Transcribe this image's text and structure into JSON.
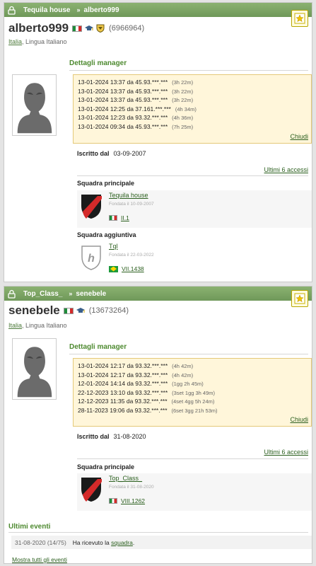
{
  "profiles": [
    {
      "breadcrumb_team": "Tequila house",
      "breadcrumb_sep": "»",
      "breadcrumb_user": "alberto999",
      "username": "alberto999",
      "user_id": "(6966964)",
      "location_country": "Italia",
      "location_lang": ", Lingua Italiano",
      "manager_details_title": "Dettagli manager",
      "log": [
        {
          "text": "13-01-2024 13:37 da 45.93.***.***",
          "dur": "(3h 22m)"
        },
        {
          "text": "13-01-2024 13:37 da 45.93.***.***",
          "dur": "(3h 22m)"
        },
        {
          "text": "13-01-2024 13:37 da 45.93.***.***",
          "dur": "(3h 22m)"
        },
        {
          "text": "13-01-2024 12:25 da 37.161.***.***",
          "dur": "(4h 34m)"
        },
        {
          "text": "13-01-2024 12:23 da 93.32.***.***",
          "dur": "(4h 36m)"
        },
        {
          "text": "13-01-2024 09:34 da 45.93.***.***",
          "dur": "(7h 25m)"
        }
      ],
      "close_label": "Chiudi",
      "registered_label": "Iscritto dal",
      "registered_date": "03-09-2007",
      "last_access_label": "Ultimi 6 accessi",
      "main_team_title": "Squadra principale",
      "main_team": {
        "name": "Tequila house",
        "founded": "Fondata il 10-09-2007",
        "division": "II.1"
      },
      "extra_team_title": "Squadra aggiuntiva",
      "extra_team": {
        "name": "Tql",
        "founded": "Fondata il 22-03-2022",
        "division": "VII.1438"
      }
    },
    {
      "breadcrumb_team": "Top_Class_",
      "breadcrumb_sep": "»",
      "breadcrumb_user": "senebele",
      "username": "senebele",
      "user_id": "(13673264)",
      "location_country": "Italia",
      "location_lang": ", Lingua Italiano",
      "manager_details_title": "Dettagli manager",
      "log": [
        {
          "text": "13-01-2024 12:17 da 93.32.***.***",
          "dur": "(4h 42m)"
        },
        {
          "text": "13-01-2024 12:17 da 93.32.***.***",
          "dur": "(4h 42m)"
        },
        {
          "text": "12-01-2024 14:14 da 93.32.***.***",
          "dur": "(1gg 2h 45m)"
        },
        {
          "text": "22-12-2023 13:10 da 93.32.***.***",
          "dur": "(3set 1gg 3h 49m)"
        },
        {
          "text": "12-12-2023 11:35 da 93.32.***.***",
          "dur": "(4set 4gg 5h 24m)"
        },
        {
          "text": "28-11-2023 19:06 da 93.32.***.***",
          "dur": "(6set 3gg 21h 53m)"
        }
      ],
      "close_label": "Chiudi",
      "registered_label": "Iscritto dal",
      "registered_date": "31-08-2020",
      "last_access_label": "Ultimi 6 accessi",
      "main_team_title": "Squadra principale",
      "main_team": {
        "name": "Top_Class_",
        "founded": "Fondata il 31-08-2020",
        "division": "VIII.1262"
      },
      "events_title": "Ultimi eventi",
      "event": {
        "date": "31-08-2020 (14/75)",
        "text_before": "Ha ricevuto la ",
        "link": "squadra",
        "text_after": "."
      },
      "all_events_label": "Mostra tutti gli eventi"
    }
  ],
  "colors": {
    "header_green": "#7aa463",
    "accent_green": "#4e8a30",
    "log_bg": "#fff6da"
  }
}
